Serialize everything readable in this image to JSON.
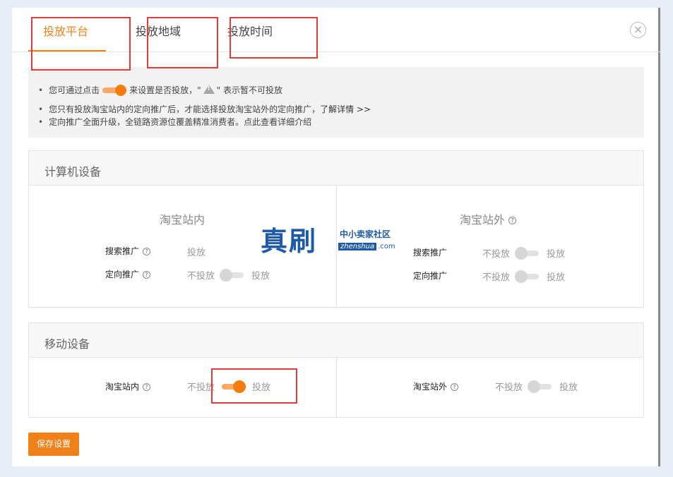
{
  "tabs": [
    {
      "label": "投放平台"
    },
    {
      "label": "投放地域"
    },
    {
      "label": "投放时间"
    }
  ],
  "close_icon": "×",
  "notice": {
    "line1_pre": "您可通过点击",
    "line1_mid": "来设置是否投放，\"",
    "line1_post": "\" 表示暂不可投放",
    "line2_text": "您只有投放淘宝站内的定向推广后，才能选择投放淘宝站外的定向推广，",
    "line2_link": "了解详情 >>",
    "line3": "定向推广全面升级，全链路资源位覆盖精准消费者。点此查看详细介绍"
  },
  "pc_section": {
    "title": "计算机设备",
    "left": {
      "title": "淘宝站内",
      "rows": [
        {
          "label": "搜索推广",
          "value": "投放"
        },
        {
          "label": "定向推广",
          "off": "不投放",
          "on": "投放",
          "enabled": false
        }
      ]
    },
    "right": {
      "title": "淘宝站外",
      "rows": [
        {
          "label": "搜索推广",
          "off": "不投放",
          "on": "投放",
          "enabled": false
        },
        {
          "label": "定向推广",
          "off": "不投放",
          "on": "投放",
          "enabled": false
        }
      ]
    }
  },
  "mobile_section": {
    "title": "移动设备",
    "left": {
      "label": "淘宝站内",
      "off": "不投放",
      "on": "投放",
      "enabled": true
    },
    "right": {
      "label": "淘宝站外",
      "off": "不投放",
      "on": "投放",
      "enabled": false
    }
  },
  "help_mark": "?",
  "watermark": {
    "big": "真刷",
    "small": "中小卖家社区",
    "url_box": "zhenshua",
    "url_tail": ".com"
  },
  "save_button": "保存设置",
  "colors": {
    "accent": "#f08119",
    "highlight_box": "#e23b3b"
  }
}
